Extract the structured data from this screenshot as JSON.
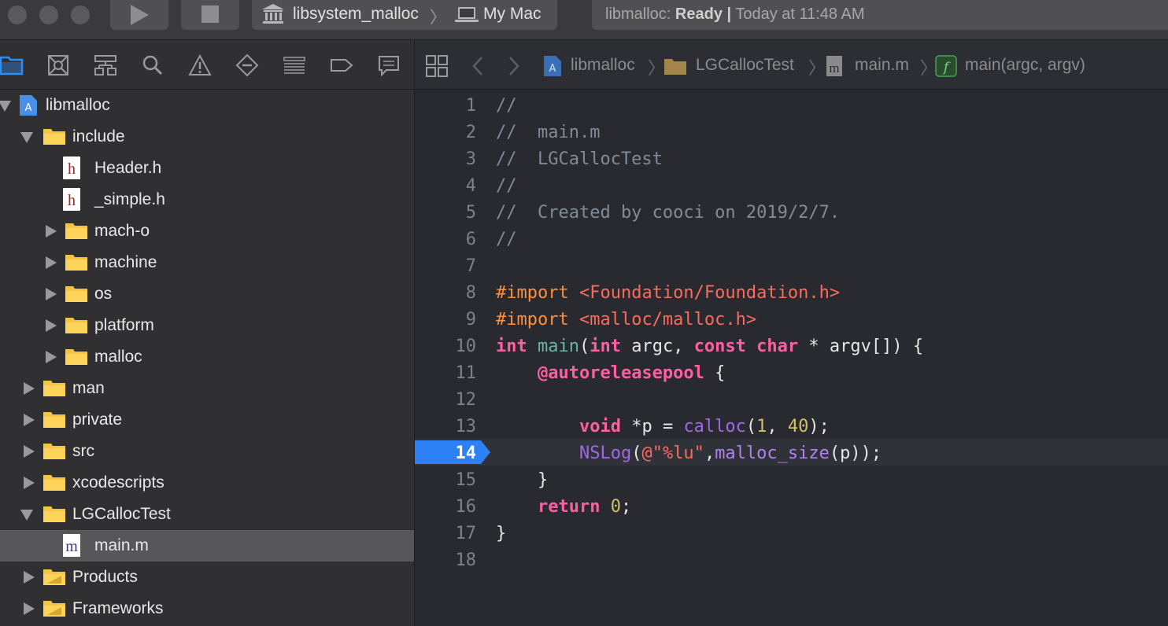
{
  "toolbar": {
    "scheme_target": "libsystem_malloc",
    "scheme_destination": "My Mac",
    "status_target": "libmalloc:",
    "status_state": "Ready",
    "status_sep": "|",
    "status_time": "Today at 11:48 AM"
  },
  "navigator": {
    "tabs": [
      "project-navigator-icon",
      "source-control-icon",
      "symbol-navigator-icon",
      "find-icon",
      "issue-navigator-icon",
      "test-navigator-icon",
      "debug-navigator-icon",
      "breakpoint-navigator-icon",
      "report-navigator-icon"
    ],
    "tree": [
      {
        "label": "libmalloc",
        "kind": "project",
        "indent": 0,
        "expanded": true
      },
      {
        "label": "include",
        "kind": "folder",
        "indent": 1,
        "expanded": true
      },
      {
        "label": "Header.h",
        "kind": "file-h",
        "indent": 2
      },
      {
        "label": "_simple.h",
        "kind": "file-h",
        "indent": 2
      },
      {
        "label": "mach-o",
        "kind": "folder",
        "indent": 2,
        "expanded": false
      },
      {
        "label": "machine",
        "kind": "folder",
        "indent": 2,
        "expanded": false
      },
      {
        "label": "os",
        "kind": "folder",
        "indent": 2,
        "expanded": false
      },
      {
        "label": "platform",
        "kind": "folder",
        "indent": 2,
        "expanded": false
      },
      {
        "label": "malloc",
        "kind": "folder",
        "indent": 2,
        "expanded": false
      },
      {
        "label": "man",
        "kind": "folder",
        "indent": 1,
        "expanded": false
      },
      {
        "label": "private",
        "kind": "folder",
        "indent": 1,
        "expanded": false
      },
      {
        "label": "src",
        "kind": "folder",
        "indent": 1,
        "expanded": false
      },
      {
        "label": "xcodescripts",
        "kind": "folder",
        "indent": 1,
        "expanded": false
      },
      {
        "label": "LGCallocTest",
        "kind": "folder",
        "indent": 1,
        "expanded": true
      },
      {
        "label": "main.m",
        "kind": "file-m",
        "indent": 2,
        "selected": true
      },
      {
        "label": "Products",
        "kind": "group-folder",
        "indent": 1,
        "expanded": false
      },
      {
        "label": "Frameworks",
        "kind": "group-folder",
        "indent": 1,
        "expanded": false
      }
    ]
  },
  "jumpbar": {
    "project": "libmalloc",
    "group": "LGCallocTest",
    "file": "main.m",
    "symbol": "main(argc, argv)"
  },
  "editor": {
    "breakpoint_line": 14,
    "lines": [
      [
        {
          "t": "//",
          "c": "com"
        }
      ],
      [
        {
          "t": "//  main.m",
          "c": "com"
        }
      ],
      [
        {
          "t": "//  LGCallocTest",
          "c": "com"
        }
      ],
      [
        {
          "t": "//",
          "c": "com"
        }
      ],
      [
        {
          "t": "//  Created by cooci on 2019/2/7.",
          "c": "com"
        }
      ],
      [
        {
          "t": "//",
          "c": "com"
        }
      ],
      [],
      [
        {
          "t": "#import ",
          "c": "pp"
        },
        {
          "t": "<Foundation/Foundation.h>",
          "c": "str"
        }
      ],
      [
        {
          "t": "#import ",
          "c": "pp"
        },
        {
          "t": "<malloc/malloc.h>",
          "c": "str"
        }
      ],
      [
        {
          "t": "int ",
          "c": "kw"
        },
        {
          "t": "main",
          "c": "fn"
        },
        {
          "t": "(",
          "c": "pl"
        },
        {
          "t": "int ",
          "c": "kw"
        },
        {
          "t": "argc, ",
          "c": "pl"
        },
        {
          "t": "const ",
          "c": "kw"
        },
        {
          "t": "char ",
          "c": "kw"
        },
        {
          "t": "* argv[]) {",
          "c": "pl"
        }
      ],
      [
        {
          "t": "    ",
          "c": "pl"
        },
        {
          "t": "@autoreleasepool",
          "c": "kw"
        },
        {
          "t": " {",
          "c": "pl"
        }
      ],
      [],
      [
        {
          "t": "        ",
          "c": "pl"
        },
        {
          "t": "void ",
          "c": "kw"
        },
        {
          "t": "*p = ",
          "c": "pl"
        },
        {
          "t": "calloc",
          "c": "sys"
        },
        {
          "t": "(",
          "c": "pl"
        },
        {
          "t": "1",
          "c": "num"
        },
        {
          "t": ", ",
          "c": "pl"
        },
        {
          "t": "40",
          "c": "num"
        },
        {
          "t": ");",
          "c": "pl"
        }
      ],
      [
        {
          "t": "        ",
          "c": "pl"
        },
        {
          "t": "NSLog",
          "c": "sys"
        },
        {
          "t": "(",
          "c": "pl"
        },
        {
          "t": "@\"%lu\"",
          "c": "str"
        },
        {
          "t": ",",
          "c": "pl"
        },
        {
          "t": "malloc_size",
          "c": "sysf"
        },
        {
          "t": "(p));",
          "c": "pl"
        }
      ],
      [
        {
          "t": "    }",
          "c": "pl"
        }
      ],
      [
        {
          "t": "    ",
          "c": "pl"
        },
        {
          "t": "return ",
          "c": "kw"
        },
        {
          "t": "0",
          "c": "num"
        },
        {
          "t": ";",
          "c": "pl"
        }
      ],
      [
        {
          "t": "}",
          "c": "pl"
        }
      ],
      []
    ]
  }
}
